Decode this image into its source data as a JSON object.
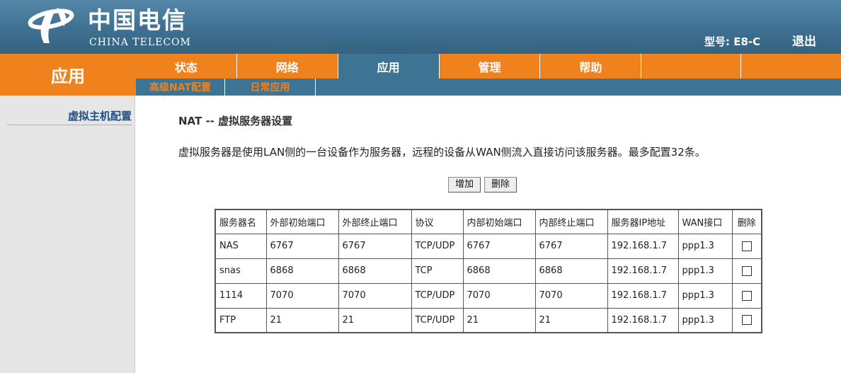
{
  "header": {
    "logo_cn": "中国电信",
    "logo_en": "CHINA TELECOM",
    "model": "型号: E8-C",
    "logout": "退出"
  },
  "section_title": "应用",
  "main_nav": [
    {
      "label": "状态",
      "active": false
    },
    {
      "label": "网络",
      "active": false
    },
    {
      "label": "应用",
      "active": true
    },
    {
      "label": "管理",
      "active": false
    },
    {
      "label": "帮助",
      "active": false
    }
  ],
  "sub_nav": [
    {
      "label": "高级NAT配置"
    },
    {
      "label": "日常应用"
    }
  ],
  "sidebar": {
    "items": [
      {
        "label": "虚拟主机配置"
      }
    ]
  },
  "content": {
    "title": "NAT -- 虚拟服务器设置",
    "description": "虚拟服务器是使用LAN侧的一台设备作为服务器，远程的设备从WAN侧流入直接访问该服务器。最多配置32条。",
    "add_label": "增加",
    "delete_label": "删除"
  },
  "table": {
    "headers": [
      "服务器名",
      "外部初始端口",
      "外部终止端口",
      "协议",
      "内部初始端口",
      "内部终止端口",
      "服务器IP地址",
      "WAN接口",
      "删除"
    ],
    "rows": [
      [
        "NAS",
        "6767",
        "6767",
        "TCP/UDP",
        "6767",
        "6767",
        "192.168.1.7",
        "ppp1.3"
      ],
      [
        "snas",
        "6868",
        "6868",
        "TCP",
        "6868",
        "6868",
        "192.168.1.7",
        "ppp1.3"
      ],
      [
        "1114",
        "7070",
        "7070",
        "TCP/UDP",
        "7070",
        "7070",
        "192.168.1.7",
        "ppp1.3"
      ],
      [
        "FTP",
        "21",
        "21",
        "TCP/UDP",
        "21",
        "21",
        "192.168.1.7",
        "ppp1.3"
      ]
    ]
  },
  "colors": {
    "header_blue": "#3f7091",
    "nav_orange": "#f0821e",
    "sidebar_gray": "#e6e6e6",
    "link_blue": "#1f4f86"
  }
}
